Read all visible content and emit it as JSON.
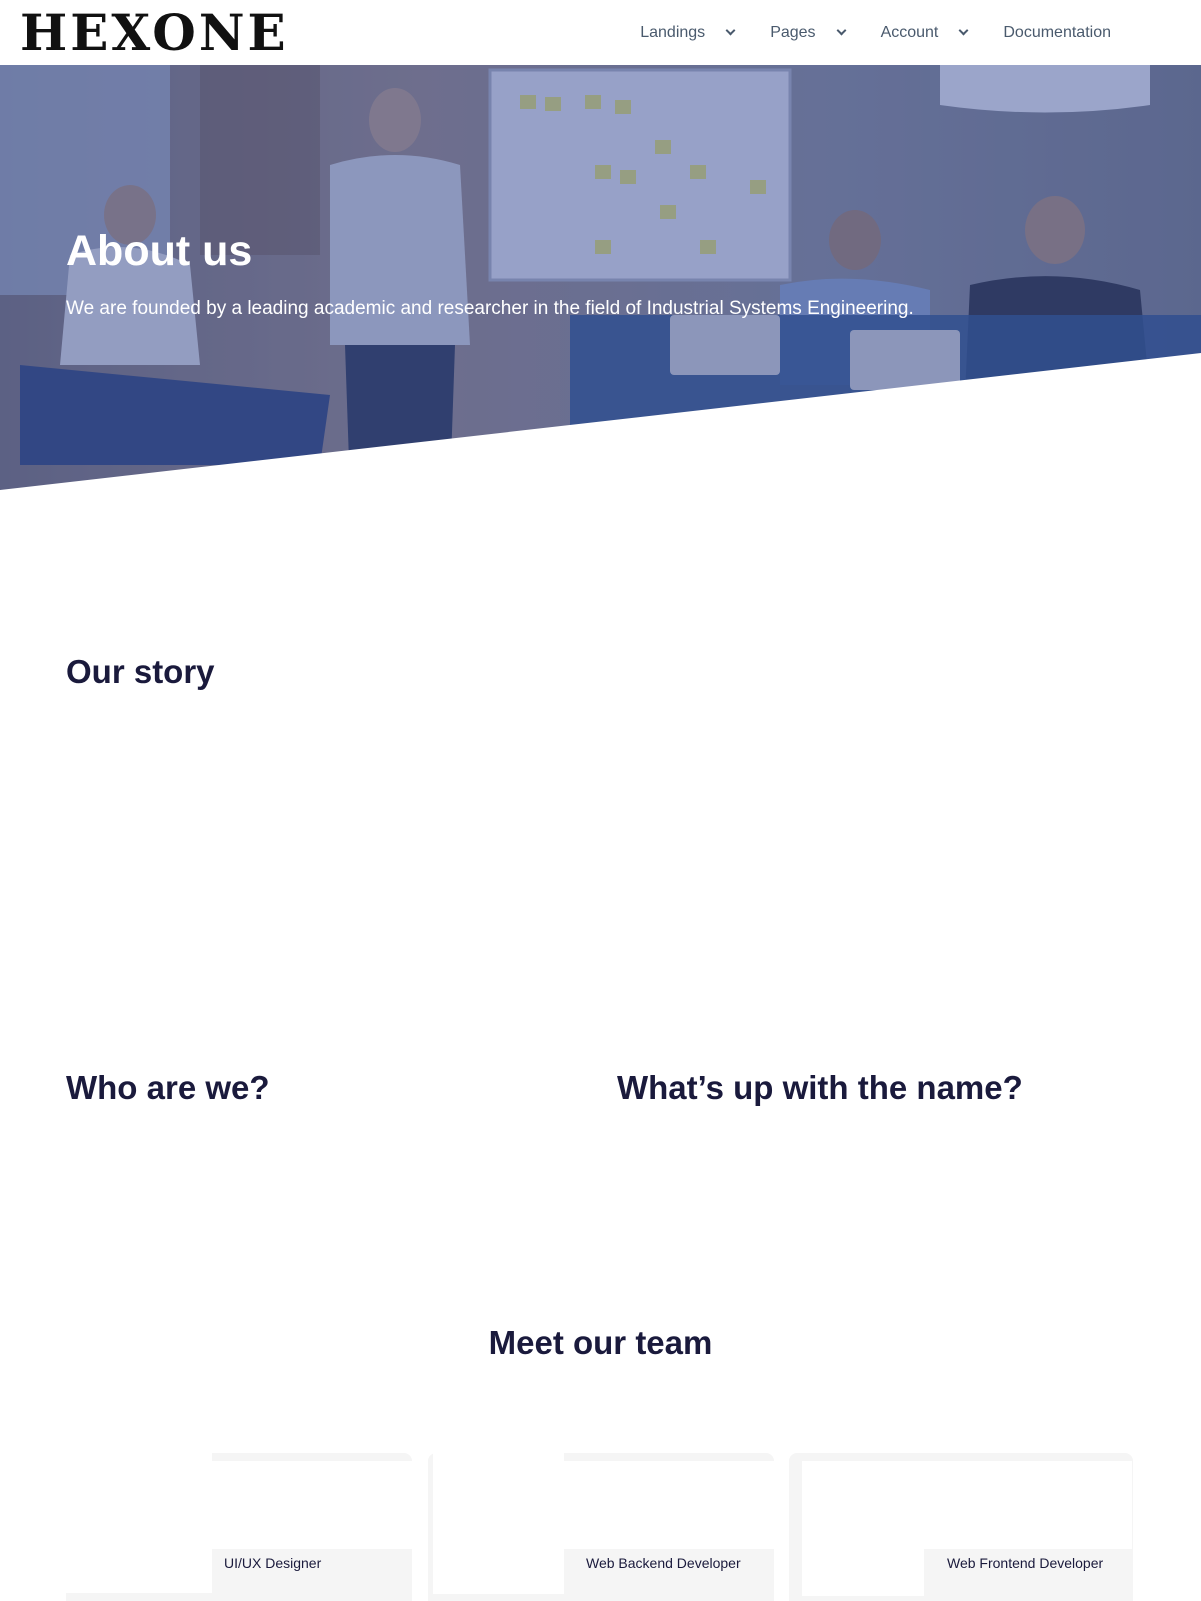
{
  "header": {
    "logo": "HEXONE",
    "nav": [
      {
        "label": "Landings",
        "has_dropdown": true
      },
      {
        "label": "Pages",
        "has_dropdown": true
      },
      {
        "label": "Account",
        "has_dropdown": true
      },
      {
        "label": "Documentation",
        "has_dropdown": false
      }
    ]
  },
  "hero": {
    "title": "About us",
    "subtitle": "We are founded by a leading academic and researcher in the field of Industrial Systems Engineering."
  },
  "sections": {
    "our_story": "Our story",
    "who_are_we": "Who are we?",
    "name": "What’s up with the name?",
    "team": "Meet our team"
  },
  "team": [
    {
      "role": "UI/UX Designer"
    },
    {
      "role": "Web Backend Developer"
    },
    {
      "role": "Web Frontend Developer"
    }
  ],
  "colors": {
    "heading": "#1a1a3c",
    "nav_text": "#4a5a6d",
    "hero_overlay": "#3a4f9a",
    "card_bg": "#f5f5f5"
  }
}
